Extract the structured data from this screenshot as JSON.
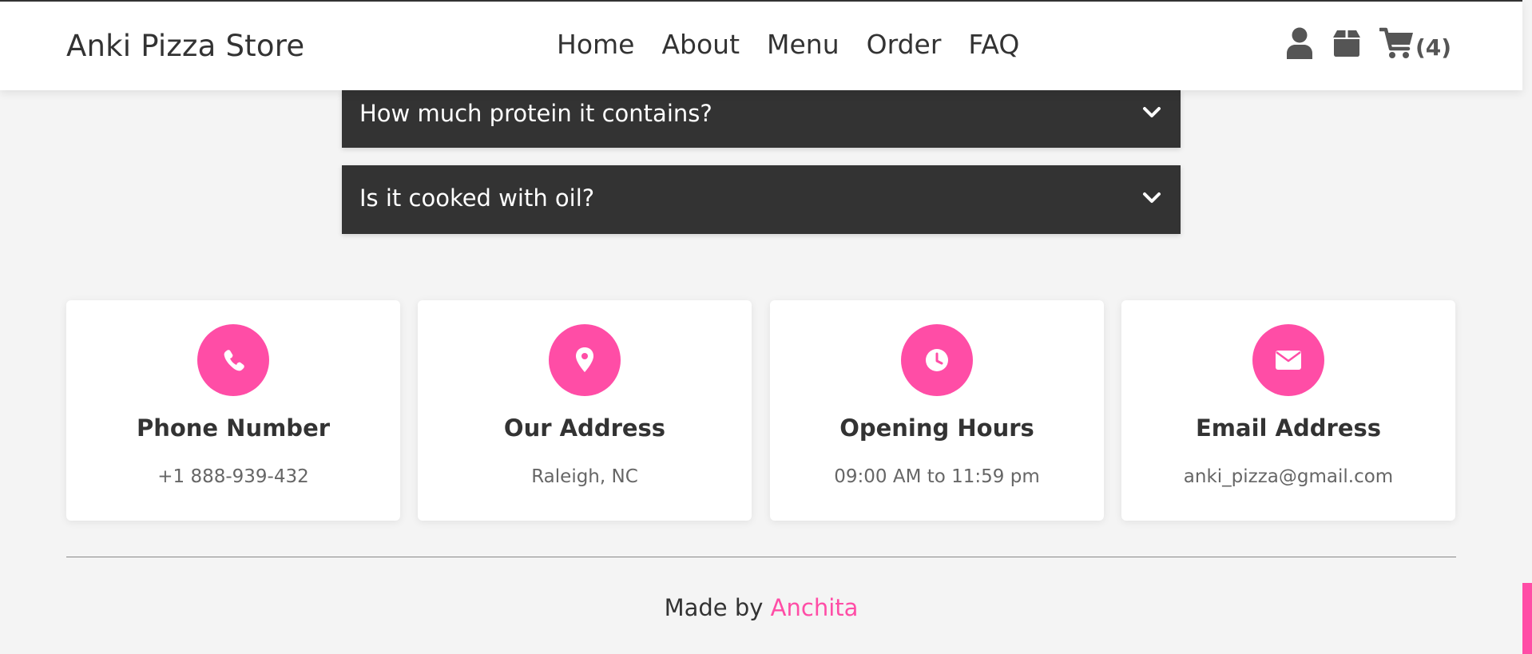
{
  "header": {
    "logo": "Anki Pizza Store",
    "nav": [
      "Home",
      "About",
      "Menu",
      "Order",
      "FAQ"
    ],
    "cart_count": "(4)",
    "icons": [
      "user-icon",
      "box-icon",
      "cart-icon"
    ]
  },
  "faq": [
    {
      "question": "How much protein it contains?"
    },
    {
      "question": "Is it cooked with oil?"
    }
  ],
  "info_cards": [
    {
      "icon": "phone-icon",
      "title": "Phone Number",
      "value": "+1 888-939-432"
    },
    {
      "icon": "location-pin-icon",
      "title": "Our Address",
      "value": "Raleigh, NC"
    },
    {
      "icon": "clock-icon",
      "title": "Opening Hours",
      "value": "09:00 AM to 11:59 pm"
    },
    {
      "icon": "envelope-icon",
      "title": "Email Address",
      "value": "anki_pizza@gmail.com"
    }
  ],
  "footer": {
    "prefix": "Made by",
    "author": "Anchita"
  },
  "colors": {
    "accent": "#ff4da6",
    "faq_background": "#333333",
    "page_background": "#f4f4f4"
  }
}
